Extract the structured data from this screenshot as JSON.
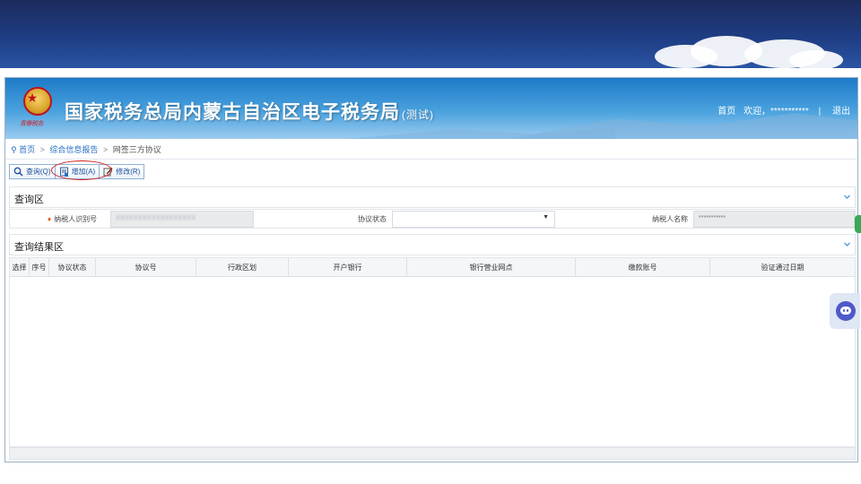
{
  "app": {
    "title": "国家税务总局内蒙古自治区电子税务局",
    "title_suffix": "(测试)",
    "seal_text": "青春税务"
  },
  "top_nav": {
    "home": "首页",
    "welcome": "欢迎，***********",
    "separator": "|",
    "logout": "退出"
  },
  "breadcrumb": {
    "home": "首页",
    "section": "综合信息报告",
    "current": "网签三方协议",
    "separator": ">"
  },
  "toolbar": {
    "query_label": "查询(Q)",
    "add_label": "增加(A)",
    "modify_label": "修改(R)"
  },
  "query_area": {
    "title": "查询区",
    "fields": {
      "taxpayer_id_label": "纳税人识别号",
      "taxpayer_id_value": "XXXXXXXXXXXXXXXXXX",
      "agreement_status_label": "协议状态",
      "agreement_status_value": "",
      "taxpayer_name_label": "纳税人名称",
      "taxpayer_name_value": "***********"
    }
  },
  "result_area": {
    "title": "查询结果区",
    "columns": [
      "选择",
      "序号",
      "协议状态",
      "协议号",
      "行政区划",
      "开户银行",
      "银行营业网点",
      "缴款账号",
      "验证通过日期"
    ],
    "rows": []
  },
  "colors": {
    "header_blue": "#1e7ac8",
    "link_blue": "#2a72c2",
    "highlight_red": "#d21c1c",
    "required_orange": "#e65a1c",
    "service_purple": "#4f59c9"
  },
  "icons": {
    "collapse": "chevron-down-icon",
    "query": "search-icon",
    "add": "add-document-icon",
    "modify": "edit-icon",
    "location": "map-pin-icon"
  }
}
